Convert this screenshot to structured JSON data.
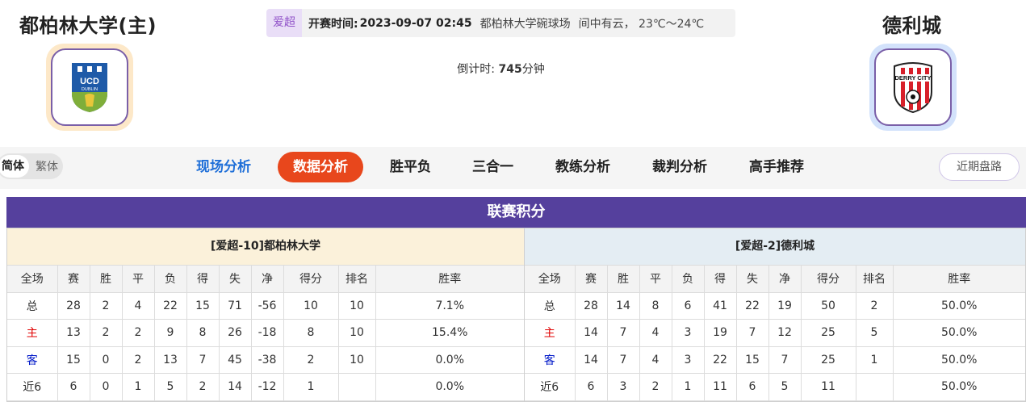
{
  "header": {
    "home_team": "都柏林大学(主)",
    "away_team": "德利城",
    "league_tag": "爱超",
    "kickoff_label": "开赛时间:",
    "kickoff_time": "2023-09-07 02:45",
    "venue": "都柏林大学碗球场",
    "weather": "间中有云， 23℃～24℃",
    "countdown_label": "倒计时:",
    "countdown_value": "745",
    "countdown_unit": "分钟"
  },
  "logos": {
    "home_text": "UCD",
    "home_sub": "DUBLIN",
    "away_text": "DERRY CITY"
  },
  "nav": {
    "lang_simplified": "简体",
    "lang_traditional": "繁体",
    "tabs": [
      "现场分析",
      "数据分析",
      "胜平负",
      "三合一",
      "教练分析",
      "裁判分析",
      "高手推荐"
    ],
    "recent_btn": "近期盘路"
  },
  "standings": {
    "title": "联赛积分",
    "columns": [
      "全场",
      "赛",
      "胜",
      "平",
      "负",
      "得",
      "失",
      "净",
      "得分",
      "排名",
      "胜率"
    ],
    "home": {
      "header": "[爱超-10]都柏林大学",
      "rows": [
        [
          "总",
          "28",
          "2",
          "4",
          "22",
          "15",
          "71",
          "-56",
          "10",
          "10",
          "7.1%"
        ],
        [
          "主",
          "13",
          "2",
          "2",
          "9",
          "8",
          "26",
          "-18",
          "8",
          "10",
          "15.4%"
        ],
        [
          "客",
          "15",
          "0",
          "2",
          "13",
          "7",
          "45",
          "-38",
          "2",
          "10",
          "0.0%"
        ],
        [
          "近6",
          "6",
          "0",
          "1",
          "5",
          "2",
          "14",
          "-12",
          "1",
          "",
          "0.0%"
        ]
      ]
    },
    "away": {
      "header": "[爱超-2]德利城",
      "rows": [
        [
          "总",
          "28",
          "14",
          "8",
          "6",
          "41",
          "22",
          "19",
          "50",
          "2",
          "50.0%"
        ],
        [
          "主",
          "14",
          "7",
          "4",
          "3",
          "19",
          "7",
          "12",
          "25",
          "5",
          "50.0%"
        ],
        [
          "客",
          "14",
          "7",
          "4",
          "3",
          "22",
          "15",
          "7",
          "25",
          "1",
          "50.0%"
        ],
        [
          "近6",
          "6",
          "3",
          "2",
          "1",
          "11",
          "6",
          "5",
          "11",
          "",
          "50.0%"
        ]
      ]
    }
  },
  "colors": {
    "accent_purple": "#55409d",
    "active_tab": "#e8471c",
    "home_row_label": "#e00000",
    "away_row_label": "#0018c8"
  }
}
